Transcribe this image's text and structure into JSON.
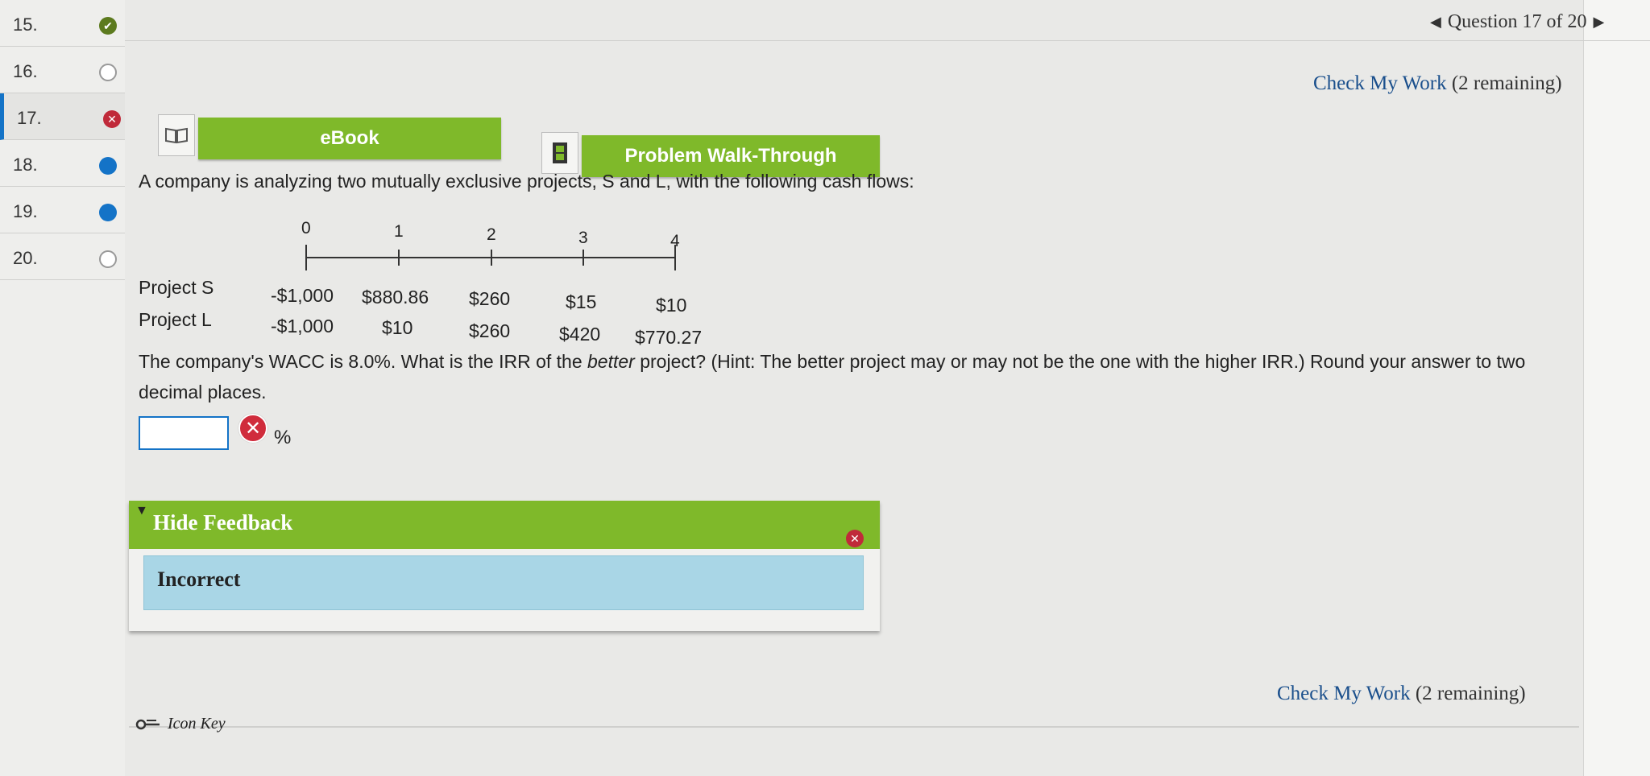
{
  "nav": {
    "items": [
      {
        "number": "15.",
        "status": "correct",
        "glyph": "✔"
      },
      {
        "number": "16.",
        "status": "empty",
        "glyph": ""
      },
      {
        "number": "17.",
        "status": "wrong",
        "glyph": "✕"
      },
      {
        "number": "18.",
        "status": "answered",
        "glyph": ""
      },
      {
        "number": "19.",
        "status": "answered",
        "glyph": ""
      },
      {
        "number": "20.",
        "status": "empty",
        "glyph": ""
      }
    ]
  },
  "header": {
    "prev_arrow": "◀",
    "question_counter": "Question 17 of 20",
    "next_arrow": "▶",
    "check_work_label": "Check My Work",
    "check_work_remaining": "(2 remaining)"
  },
  "resources": {
    "ebook_label": "eBook",
    "walkthrough_label": "Problem Walk-Through"
  },
  "problem": {
    "prompt": "A company is analyzing two mutually exclusive projects, S and L, with the following cash flows:",
    "periods": [
      "0",
      "1",
      "2",
      "3",
      "4"
    ],
    "projects": [
      {
        "label": "Project S",
        "cash_flows": [
          "-$1,000",
          "$880.86",
          "$260",
          "$15",
          "$10"
        ]
      },
      {
        "label": "Project L",
        "cash_flows": [
          "-$1,000",
          "$10",
          "$260",
          "$420",
          "$770.27"
        ]
      }
    ],
    "question_part1": "The company's WACC is 8.0%. What is the IRR of the ",
    "question_emphasis": "better",
    "question_part2": " project? (Hint: The better project may or may not be the one with the higher IRR.) Round your answer to two decimal places.",
    "answer_value": "",
    "unit": "%"
  },
  "feedback": {
    "toggle_label": "Hide Feedback",
    "result": "Incorrect"
  },
  "footer": {
    "icon_key_label": "Icon Key"
  },
  "colors": {
    "accent_green": "#7fb92a",
    "link_blue": "#1a4f8c",
    "feedback_blue": "#a9d6e6",
    "wrong_red": "#c02a3a"
  }
}
